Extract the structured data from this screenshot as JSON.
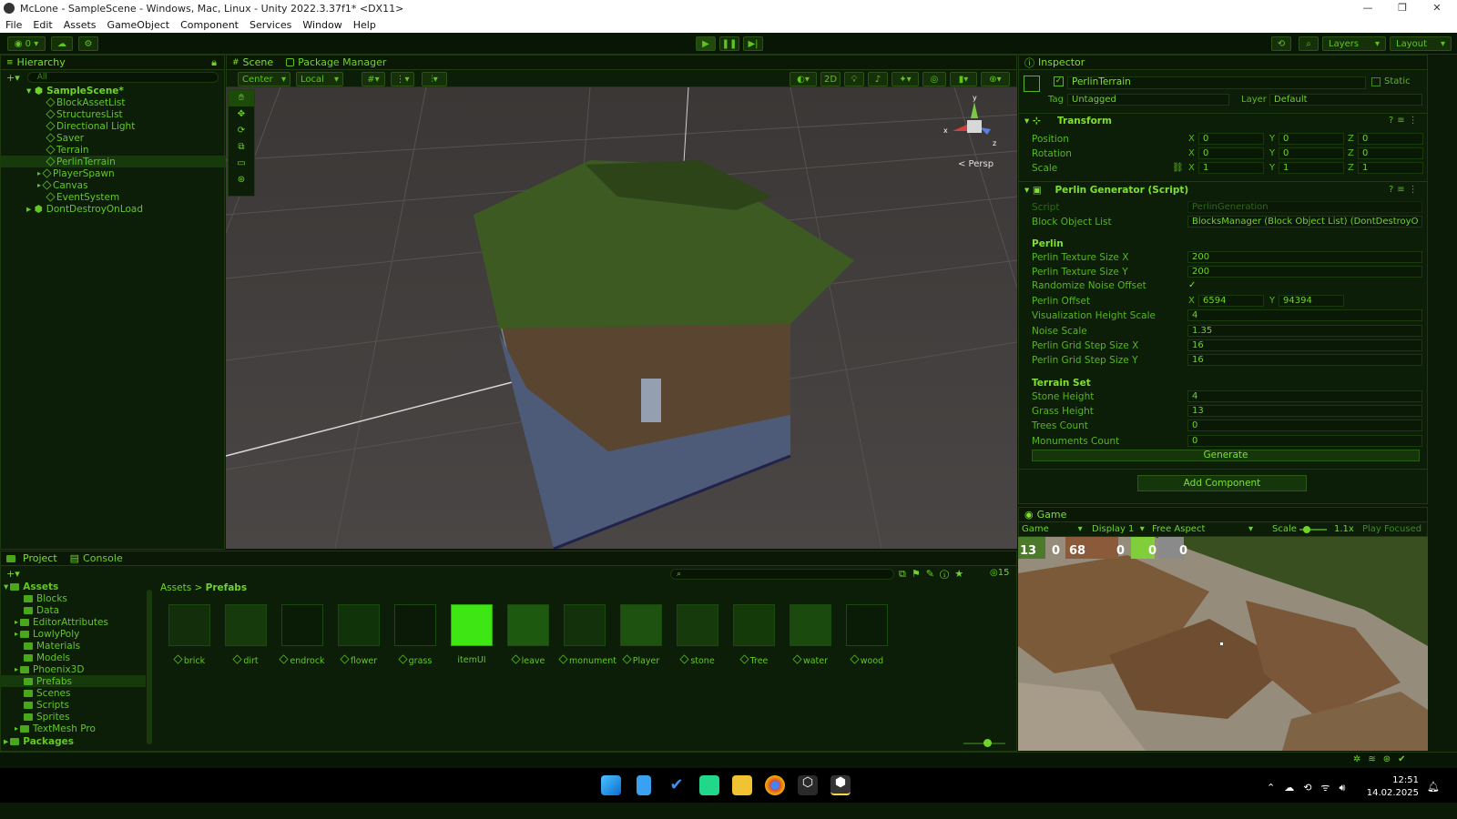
{
  "window": {
    "title": "McLone - SampleScene - Windows, Mac, Linux - Unity 2022.3.37f1* <DX11>"
  },
  "menu": [
    "File",
    "Edit",
    "Assets",
    "GameObject",
    "Component",
    "Services",
    "Window",
    "Help"
  ],
  "toolbar": {
    "account_count": "0",
    "layers_label": "Layers",
    "layout_label": "Layout"
  },
  "hierarchy": {
    "tab": "Hierarchy",
    "search_placeholder": "All",
    "items": [
      "SampleScene*",
      "BlockAssetList",
      "StructuresList",
      "Directional Light",
      "Saver",
      "Terrain",
      "PerlinTerrain",
      "PlayerSpawn",
      "Canvas",
      "EventSystem",
      "DontDestroyOnLoad"
    ]
  },
  "scene": {
    "tabs": [
      "Scene",
      "Package Manager"
    ],
    "pivot": "Center",
    "space": "Local",
    "mode_2d": "2D",
    "persp": "< Persp",
    "gizmo_x": "x",
    "gizmo_y": "y",
    "gizmo_z": "z"
  },
  "inspector": {
    "tab": "Inspector",
    "object_name": "PerlinTerrain",
    "static_label": "Static",
    "tag_label": "Tag",
    "tag_value": "Untagged",
    "layer_label": "Layer",
    "layer_value": "Default",
    "transform": {
      "title": "Transform",
      "position_label": "Position",
      "rotation_label": "Rotation",
      "scale_label": "Scale",
      "x": "X",
      "y": "Y",
      "z": "Z",
      "position": [
        "0",
        "0",
        "0"
      ],
      "rotation": [
        "0",
        "0",
        "0"
      ],
      "scale": [
        "1",
        "1",
        "1"
      ]
    },
    "script_component": {
      "title": "Perlin Generator (Script)",
      "script_label": "Script",
      "script_value": "PerlinGeneration",
      "block_label": "Block Object List",
      "block_value": "BlocksManager (Block Object List) (DontDestroyO",
      "perlin_header": "Perlin",
      "tex_x_label": "Perlin Texture Size X",
      "tex_x": "200",
      "tex_y_label": "Perlin Texture Size Y",
      "tex_y": "200",
      "randomize_label": "Randomize Noise Offset",
      "randomize_check": "✓",
      "offset_label": "Perlin Offset",
      "offset_x": "6594",
      "offset_y": "94394",
      "vis_label": "Visualization Height Scale",
      "vis": "4",
      "noise_label": "Noise Scale",
      "noise": "1.35",
      "step_x_label": "Perlin Grid Step Size X",
      "step_x": "16",
      "step_y_label": "Perlin Grid Step Size Y",
      "step_y": "16",
      "terrain_header": "Terrain Set",
      "stone_label": "Stone Height",
      "stone": "4",
      "grass_label": "Grass Height",
      "grass": "13",
      "trees_label": "Trees Count",
      "trees": "0",
      "monuments_label": "Monuments Count",
      "monuments": "0",
      "generate_button": "Generate"
    },
    "add_component": "Add Component"
  },
  "game": {
    "tab": "Game",
    "mode": "Game",
    "display": "Display 1",
    "aspect": "Free Aspect",
    "scale_label": "Scale",
    "scale_value": "1.1x",
    "play_focused": "Play Focused",
    "hud_counts": [
      "13",
      "0",
      "68",
      "0",
      "0",
      "0"
    ]
  },
  "project": {
    "tabs": [
      "Project",
      "Console"
    ],
    "hidden_count": "15",
    "breadcrumb": [
      "Assets",
      "Prefabs"
    ],
    "tree": [
      "Assets",
      "Blocks",
      "Data",
      "EditorAttributes",
      "LowlyPoly",
      "Materials",
      "Models",
      "Phoenix3D",
      "Prefabs",
      "Scenes",
      "Scripts",
      "Sprites",
      "TextMesh Pro",
      "Packages"
    ],
    "assets": [
      "brick",
      "dirt",
      "endrock",
      "flower",
      "grass",
      "itemUI",
      "leave",
      "monument",
      "Player",
      "stone",
      "Tree",
      "water",
      "wood"
    ]
  },
  "taskbar": {
    "time": "12:51",
    "date": "14.02.2025"
  },
  "colors": {
    "accent": "#6fd42a",
    "panel_bg": "#0c1e07",
    "selection": "#163a0b"
  }
}
